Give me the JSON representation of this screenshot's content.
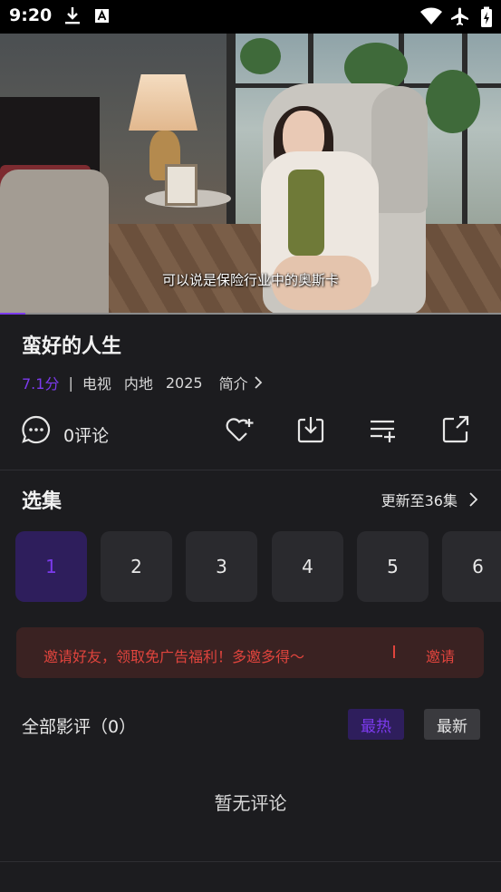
{
  "status_bar": {
    "time": "9:20"
  },
  "video": {
    "subtitle": "可以说是保险行业中的奥斯卡",
    "progress": 0.05
  },
  "show": {
    "title": "蛮好的人生",
    "score": "7.1分",
    "separator": "|",
    "type": "电视",
    "region": "内地",
    "year": "2025",
    "intro_label": "简介"
  },
  "actions": {
    "comment_count": "0评论"
  },
  "episodes": {
    "title": "选集",
    "update_text": "更新至36集",
    "items": [
      "1",
      "2",
      "3",
      "4",
      "5",
      "6"
    ],
    "active_index": 0
  },
  "invite": {
    "text": "邀请好友，领取免广告福利！多邀多得～",
    "button": "邀请"
  },
  "reviews": {
    "title": "全部影评（0）",
    "tab_hot": "最热",
    "tab_new": "最新",
    "empty_text": "暂无评论"
  },
  "colors": {
    "accent": "#7c3aed",
    "invite_red": "#e0443d",
    "background": "#1c1c1f"
  }
}
